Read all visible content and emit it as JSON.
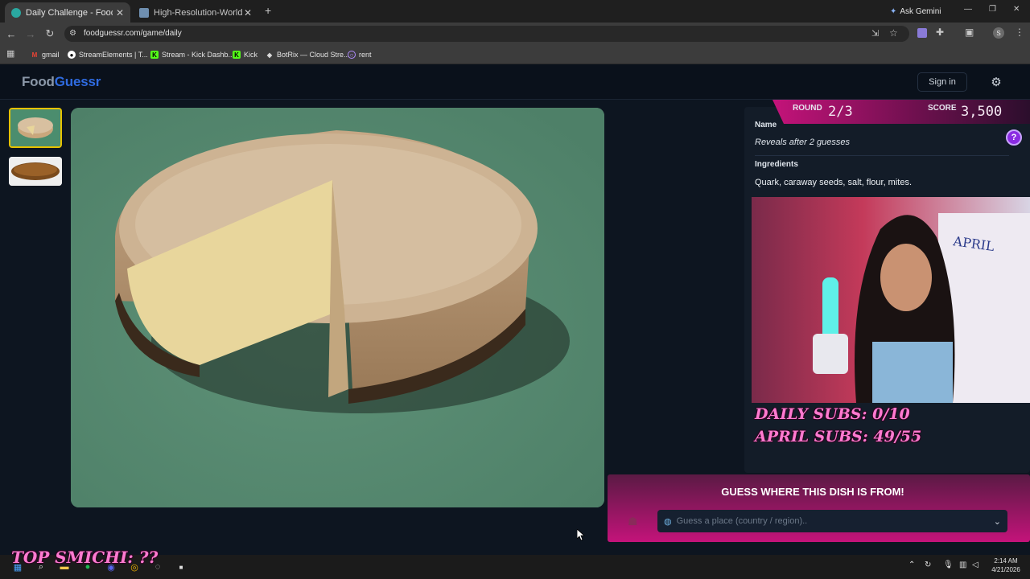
{
  "browser": {
    "tabs": [
      {
        "title": "Daily Challenge - FoodGuessr |",
        "close": "✕"
      },
      {
        "title": "High-Resolution-World-Map.jp",
        "close": "✕"
      }
    ],
    "new_tab": "+",
    "ask_gemini": "Ask Gemini",
    "url": "foodguessr.com/game/daily",
    "profile_initial": "S",
    "bookmarks": [
      {
        "label": "gmail"
      },
      {
        "label": "StreamElements | T..."
      },
      {
        "label": "Stream - Kick Dashb..."
      },
      {
        "label": "Kick"
      },
      {
        "label": "BotRix — Cloud Stre..."
      },
      {
        "label": "rent"
      }
    ],
    "window_controls": {
      "minimize": "—",
      "restore": "❐",
      "close": "✕"
    }
  },
  "site": {
    "logo_part1": "Food",
    "logo_part2": "Guessr",
    "signin": "Sign in"
  },
  "game": {
    "round_label": "ROUND",
    "round_value": "2/3",
    "score_label": "SCORE",
    "score_value": "3,500",
    "name_label": "Name",
    "name_value": "Reveals after 2 guesses",
    "ingredients_label": "Ingredients",
    "ingredients_value": "Quark, caraway seeds, salt, flour, mites.",
    "help": "?",
    "guess_title": "GUESS WHERE THIS DISH IS FROM!",
    "guess_placeholder": "Guess a place (country / region)..",
    "selected_thumbnail": 1
  },
  "overlay": {
    "daily_subs": "DAILY SUBS: 0/10",
    "april_subs": "APRIL SUBS: 49/55",
    "top_smichi": "TOP SMICHI: ??"
  },
  "taskbar": {
    "time": "2:14 AM",
    "date": "4/21/2026"
  },
  "colors": {
    "logo_food": "#8b98a8",
    "logo_guessr": "#2f6be0",
    "accent_pink": "#c4137a",
    "panel_bg": "#131c28",
    "help_purple": "#8a2be2"
  }
}
